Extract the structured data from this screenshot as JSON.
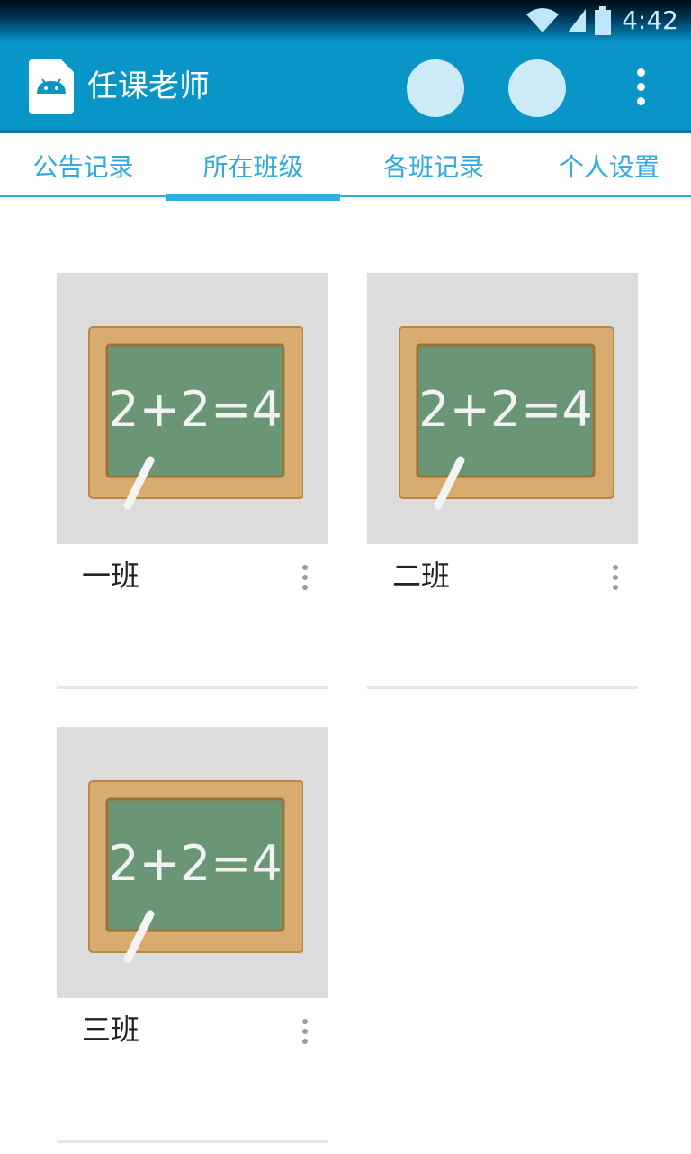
{
  "status_bar": {
    "time": "4:42",
    "icons": [
      "wifi-icon",
      "signal-icon",
      "battery-icon"
    ]
  },
  "app_bar": {
    "title": "任课老师",
    "icon": "android-app-icon",
    "actions": [
      "action-button-1",
      "action-button-2",
      "overflow-menu-icon"
    ]
  },
  "tabs": [
    {
      "label": "公告记录",
      "selected": false
    },
    {
      "label": "所在班级",
      "selected": true
    },
    {
      "label": "各班记录",
      "selected": false
    },
    {
      "label": "个人设置",
      "selected": false
    }
  ],
  "classes": [
    {
      "name": "一班",
      "board_text": "2+2=4"
    },
    {
      "name": "二班",
      "board_text": "2+2=4"
    },
    {
      "name": "三班",
      "board_text": "2+2=4"
    }
  ],
  "colors": {
    "app_bar": "#0a95c9",
    "accent": "#33aee0",
    "card_image_bg": "#dcdcdc"
  }
}
